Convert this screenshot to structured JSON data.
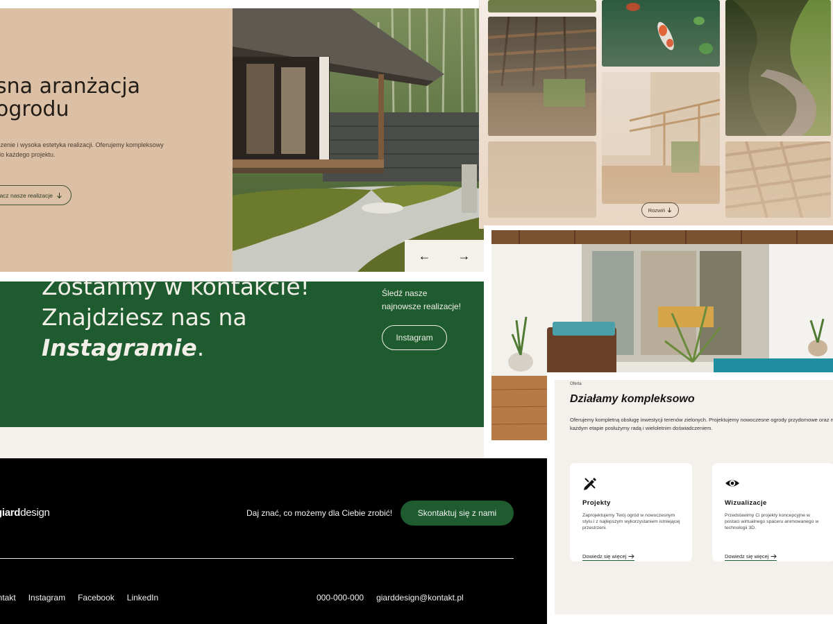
{
  "hero": {
    "title_line1": "sna aranżacja",
    "title_line2": "ogrodu",
    "desc_line1": "czenie i wysoka estetyka realizacji. Oferujemy kompleksowy",
    "desc_line2": "do każdego projektu.",
    "button_label": "acz nasze realizacje",
    "prev_arrow": "←",
    "next_arrow": "→"
  },
  "gallery": {
    "expand_label": "Rozwiń"
  },
  "instagram": {
    "title_line1": "Zostańmy w kontakcie!",
    "title_line2": "Znajdziesz nas na",
    "title_emph": "Instagramie",
    "title_end": ".",
    "side_line1": "Śledź nasze",
    "side_line2": "najnowsze realizacje!",
    "button_label": "Instagram"
  },
  "footer": {
    "logo_bold": "giard",
    "logo_rest": "design",
    "cta_text": "Daj znać, co możemy dla Ciebie zrobić!",
    "cta_button": "Skontaktuj się z nami",
    "links": [
      "ontakt",
      "Instagram",
      "Facebook",
      "LinkedIn"
    ],
    "phone": "000-000-000",
    "email": "giarddesign@kontakt.pl"
  },
  "offer": {
    "kicker": "Oferta",
    "title": "Działamy kompleksowo",
    "desc": "Oferujemy kompletną obsługę inwestycji terenów zielonych. Projektujemy nowoczesne ogrody przydomowe oraz na każdym etapie posłużymy radą i wieloletnim doświadczeniem.",
    "services": [
      {
        "icon": "pencil-ruler-icon",
        "title": "Projekty",
        "desc": "Zaprojektujemy Twój ogród w nowoczesnym stylu i z najlepszym wykorzystaniem istniejącej przestrzeni.",
        "link": "Dowiedz się więcej"
      },
      {
        "icon": "eye-icon",
        "title": "Wizualizacje",
        "desc": "Przedstawimy Ci projekty koncepcyjne w postaci wirtualnego spaceru animowanego w technologii 3D.",
        "link": "Dowiedz się więcej"
      }
    ]
  }
}
